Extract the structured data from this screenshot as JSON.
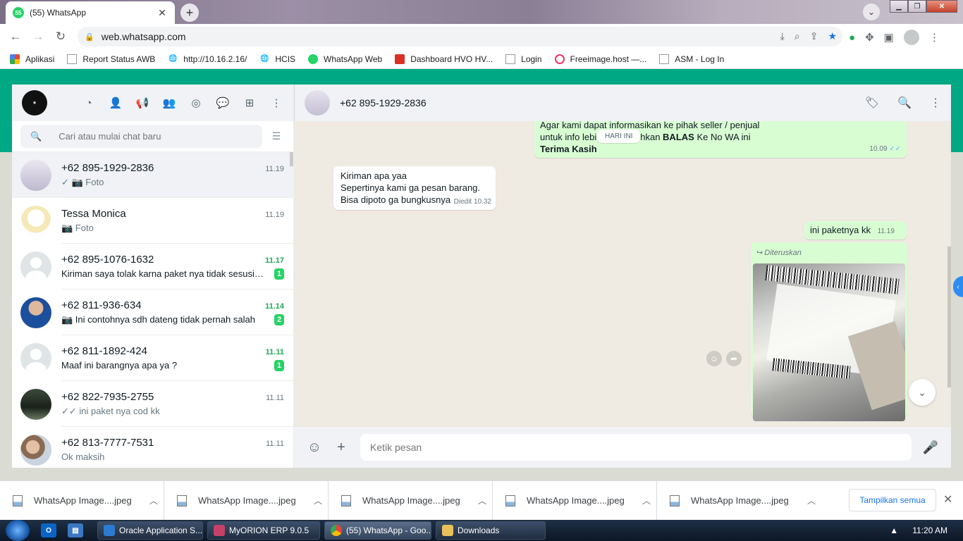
{
  "browser": {
    "tab_title": "(55) WhatsApp",
    "tab_badge": "55",
    "url": "web.whatsapp.com"
  },
  "bookmarks": [
    {
      "label": "Aplikasi",
      "icon": "apps-grid-icon"
    },
    {
      "label": "Report Status AWB",
      "icon": "page-icon"
    },
    {
      "label": "http://10.16.2.16/",
      "icon": "globe-icon"
    },
    {
      "label": "HCIS",
      "icon": "globe-icon"
    },
    {
      "label": "WhatsApp Web",
      "icon": "whatsapp-icon"
    },
    {
      "label": "Dashboard HVO HV...",
      "icon": "dashboard-icon"
    },
    {
      "label": "Login",
      "icon": "page-icon"
    },
    {
      "label": "Freeimage.host —...",
      "icon": "freeimage-icon"
    },
    {
      "label": "ASM - Log In",
      "icon": "page-icon"
    }
  ],
  "sidebar": {
    "search_placeholder": "Cari atau mulai chat baru",
    "chats": [
      {
        "name": "+62 895-1929-2836",
        "time": "11.19",
        "preview": "✓ 📷 Foto",
        "unread": "",
        "time_unread": false,
        "preview_dark": false,
        "active": true
      },
      {
        "name": "Tessa Monica",
        "time": "11.19",
        "preview": "📷 Foto",
        "unread": "",
        "time_unread": false,
        "preview_dark": false,
        "active": false
      },
      {
        "name": "+62 895-1076-1632",
        "time": "11.17",
        "preview": "Kiriman saya tolak karna paket nya tidak sesusi d...",
        "unread": "1",
        "time_unread": true,
        "preview_dark": true,
        "active": false
      },
      {
        "name": "+62 811-936-634",
        "time": "11.14",
        "preview": "📷 Ini contohnya sdh dateng tidak pernah salah",
        "unread": "2",
        "time_unread": true,
        "preview_dark": true,
        "active": false
      },
      {
        "name": "+62 811-1892-424",
        "time": "11.11",
        "preview": "Maaf ini barangnya apa ya ?",
        "unread": "1",
        "time_unread": true,
        "preview_dark": true,
        "active": false
      },
      {
        "name": "+62 822-7935-2755",
        "time": "11.11",
        "preview": "✓✓ ini paket nya cod kk",
        "unread": "",
        "time_unread": false,
        "preview_dark": false,
        "active": false
      },
      {
        "name": "+62 813-7777-7531",
        "time": "11.11",
        "preview": "Ok maksih",
        "unread": "",
        "time_unread": false,
        "preview_dark": false,
        "active": false
      }
    ]
  },
  "conversation": {
    "contact_name": "+62 895-1929-2836",
    "date_chip": "HARI INI",
    "msg1": {
      "line1": "Agar kami dapat informasikan ke pihak seller / penjual",
      "line2_a": "untuk info lebi",
      "line2_b": "hkan ",
      "line2_bold": "BALAS",
      "line2_c": " Ke No WA ini",
      "line3_bold": "Terima Kasih",
      "time": "10.09",
      "ticks": "✓✓"
    },
    "msg2": {
      "line1": "Kiriman apa yaa",
      "line2": "Sepertinya kami ga pesan barang.",
      "line3": "Bisa dipoto ga bungkusnya",
      "meta": "Diedit 10.32"
    },
    "msg3": {
      "text": "ini paketnya kk",
      "time": "11.19",
      "ticks": "✓"
    },
    "msg4": {
      "forwarded_label": "Diteruskan"
    },
    "composer_placeholder": "Ketik pesan"
  },
  "downloads": {
    "items": [
      "WhatsApp Image....jpeg",
      "WhatsApp Image....jpeg",
      "WhatsApp Image....jpeg",
      "WhatsApp Image....jpeg",
      "WhatsApp Image....jpeg"
    ],
    "show_all": "Tampilkan semua"
  },
  "taskbar": {
    "tasks": [
      "Oracle Application S...",
      "MyORION ERP 9.0.5",
      "(55) WhatsApp - Goo...",
      "Downloads"
    ],
    "clock": "11:20 AM"
  },
  "colors": {
    "whatsapp_green": "#00a884",
    "unread_green": "#25d366",
    "outgoing_bubble": "#d9fdd3"
  }
}
